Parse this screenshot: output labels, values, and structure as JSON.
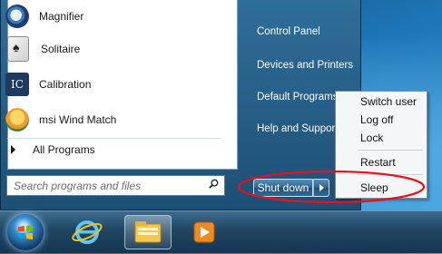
{
  "start_menu": {
    "programs": [
      {
        "label": "Magnifier",
        "icon": "magnifier-icon"
      },
      {
        "label": "Solitaire",
        "icon": "solitaire-icon"
      },
      {
        "label": "Calibration",
        "icon": "calibration-icon",
        "icon_text": "IC"
      },
      {
        "label": "msi Wind Match",
        "icon": "msi-wind-match-icon"
      }
    ],
    "all_programs_label": "All Programs",
    "search_placeholder": "Search programs and files",
    "right_items": [
      "Control Panel",
      "Devices and Printers",
      "Default Programs",
      "Help and Support"
    ],
    "shutdown_label": "Shut down"
  },
  "power_flyout": {
    "items": [
      "Switch user",
      "Log off",
      "Lock",
      "Restart",
      "Sleep"
    ]
  },
  "colors": {
    "annotation": "#e0141e",
    "menu_blue": "#1d4f75"
  },
  "taskbar": {
    "buttons": [
      "start-orb",
      "internet-explorer-icon",
      "windows-explorer-icon",
      "media-player-icon"
    ]
  }
}
